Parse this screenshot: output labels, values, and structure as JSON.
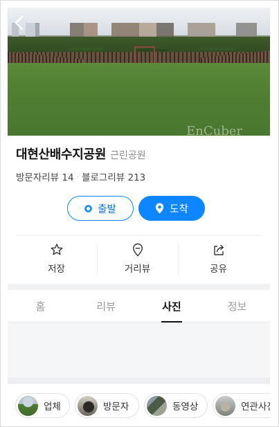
{
  "hero": {
    "watermark": "EnCuber"
  },
  "place": {
    "name": "대현산배수지공원",
    "category": "근린공원",
    "visitor_reviews_label": "방문자리뷰",
    "visitor_reviews_count": "14",
    "blog_reviews_label": "블로그리뷰",
    "blog_reviews_count": "213",
    "separator": "·"
  },
  "route": {
    "start_label": "출발",
    "arrive_label": "도착"
  },
  "actions": [
    {
      "label": "저장",
      "icon": "star-icon"
    },
    {
      "label": "거리뷰",
      "icon": "location-pin-icon"
    },
    {
      "label": "공유",
      "icon": "share-icon"
    }
  ],
  "tabs": [
    {
      "label": "홈",
      "active": false
    },
    {
      "label": "리뷰",
      "active": false
    },
    {
      "label": "사진",
      "active": true
    },
    {
      "label": "정보",
      "active": false
    }
  ],
  "chips": [
    {
      "label": "업체"
    },
    {
      "label": "방문자"
    },
    {
      "label": "동영상"
    },
    {
      "label": "연관사진"
    }
  ],
  "colors": {
    "accent": "#0d86ff",
    "text": "#222222",
    "muted": "#8a8a8a"
  }
}
